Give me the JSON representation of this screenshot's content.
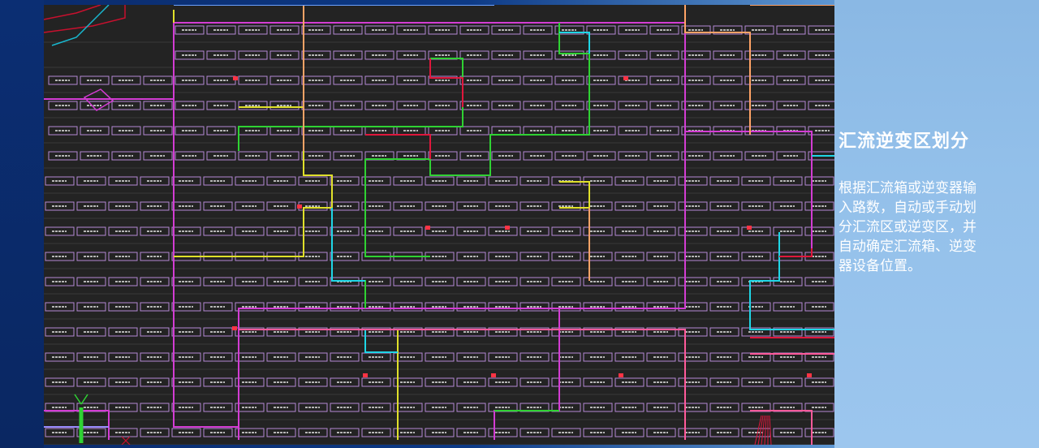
{
  "slide": {
    "title": "汇流逆变区划分",
    "description": "根据汇流箱或逆变器输入路数，自动或手动划分汇流区或逆变区，并自动确定汇流箱、逆变器设备位置。"
  },
  "cad_drawing": {
    "background": "#232323",
    "panel_row_color": "#b58ad6",
    "zone_colors": [
      "#d33cd3",
      "#2fd233",
      "#e0e02a",
      "#1fd6e6",
      "#e0173c",
      "#ffa366",
      "#ff5a9a",
      "#9a8cff"
    ]
  },
  "colors": {
    "left_band": "#0b2e73",
    "right_panel": "#93c0ea",
    "text": "#ffffff"
  }
}
